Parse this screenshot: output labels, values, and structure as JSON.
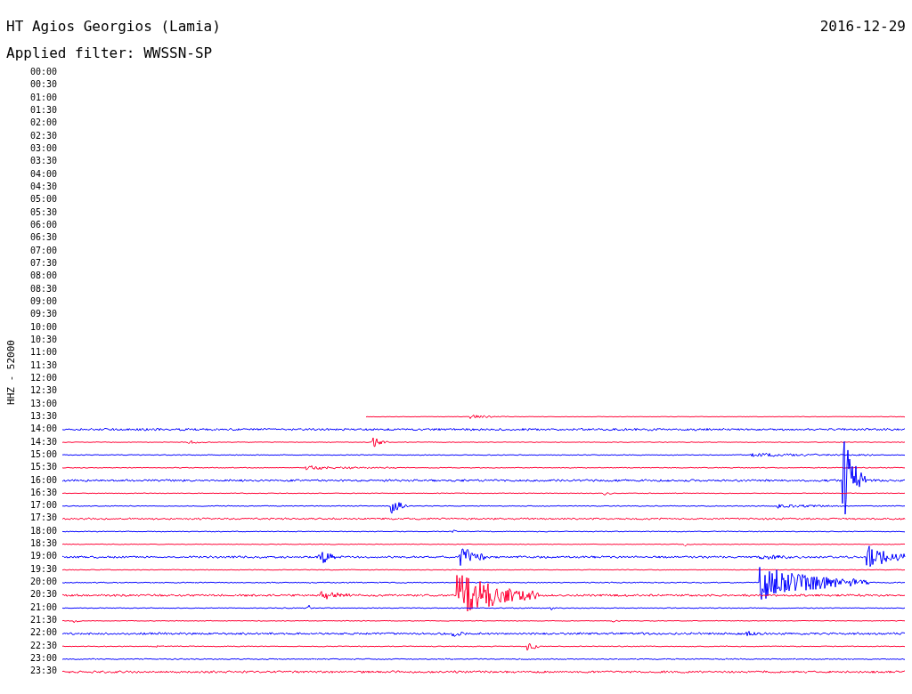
{
  "title": "HT Agios Georgios (Lamia)",
  "date": "2016-12-29",
  "filter": "Applied filter: WWSSN-SP",
  "channel": "HHZ - 52000",
  "rows": [
    {
      "time": "00:00"
    },
    {
      "time": "00:30"
    },
    {
      "time": "01:00"
    },
    {
      "time": "01:30"
    },
    {
      "time": "02:00"
    },
    {
      "time": "02:30"
    },
    {
      "time": "03:00"
    },
    {
      "time": "03:30"
    },
    {
      "time": "04:00"
    },
    {
      "time": "04:30"
    },
    {
      "time": "05:00"
    },
    {
      "time": "05:30"
    },
    {
      "time": "06:00"
    },
    {
      "time": "06:30"
    },
    {
      "time": "07:00"
    },
    {
      "time": "07:30"
    },
    {
      "time": "08:00"
    },
    {
      "time": "08:30"
    },
    {
      "time": "09:00"
    },
    {
      "time": "09:30"
    },
    {
      "time": "10:00"
    },
    {
      "time": "10:30"
    },
    {
      "time": "11:00"
    },
    {
      "time": "11:30"
    },
    {
      "time": "12:00"
    },
    {
      "time": "12:30"
    },
    {
      "time": "13:00"
    },
    {
      "time": "13:30",
      "color": "#ff0033"
    },
    {
      "time": "14:00",
      "color": "#0000ff"
    },
    {
      "time": "14:30",
      "color": "#ff0033"
    },
    {
      "time": "15:00",
      "color": "#0000ff"
    },
    {
      "time": "15:30",
      "color": "#ff0033"
    },
    {
      "time": "16:00",
      "color": "#0000ff"
    },
    {
      "time": "16:30",
      "color": "#ff0033"
    },
    {
      "time": "17:00",
      "color": "#0000ff"
    },
    {
      "time": "17:30",
      "color": "#ff0033"
    },
    {
      "time": "18:00",
      "color": "#0000ff"
    },
    {
      "time": "18:30",
      "color": "#ff0033"
    },
    {
      "time": "19:00",
      "color": "#0000ff"
    },
    {
      "time": "19:30",
      "color": "#ff0033"
    },
    {
      "time": "20:00",
      "color": "#0000ff"
    },
    {
      "time": "20:30",
      "color": "#ff0033"
    },
    {
      "time": "21:00",
      "color": "#0000ff"
    },
    {
      "time": "21:30",
      "color": "#ff0033"
    },
    {
      "time": "22:00",
      "color": "#0000ff"
    },
    {
      "time": "22:30",
      "color": "#ff0033"
    },
    {
      "time": "23:00",
      "color": "#0000ff"
    },
    {
      "time": "23:30",
      "color": "#ff0033"
    }
  ]
}
